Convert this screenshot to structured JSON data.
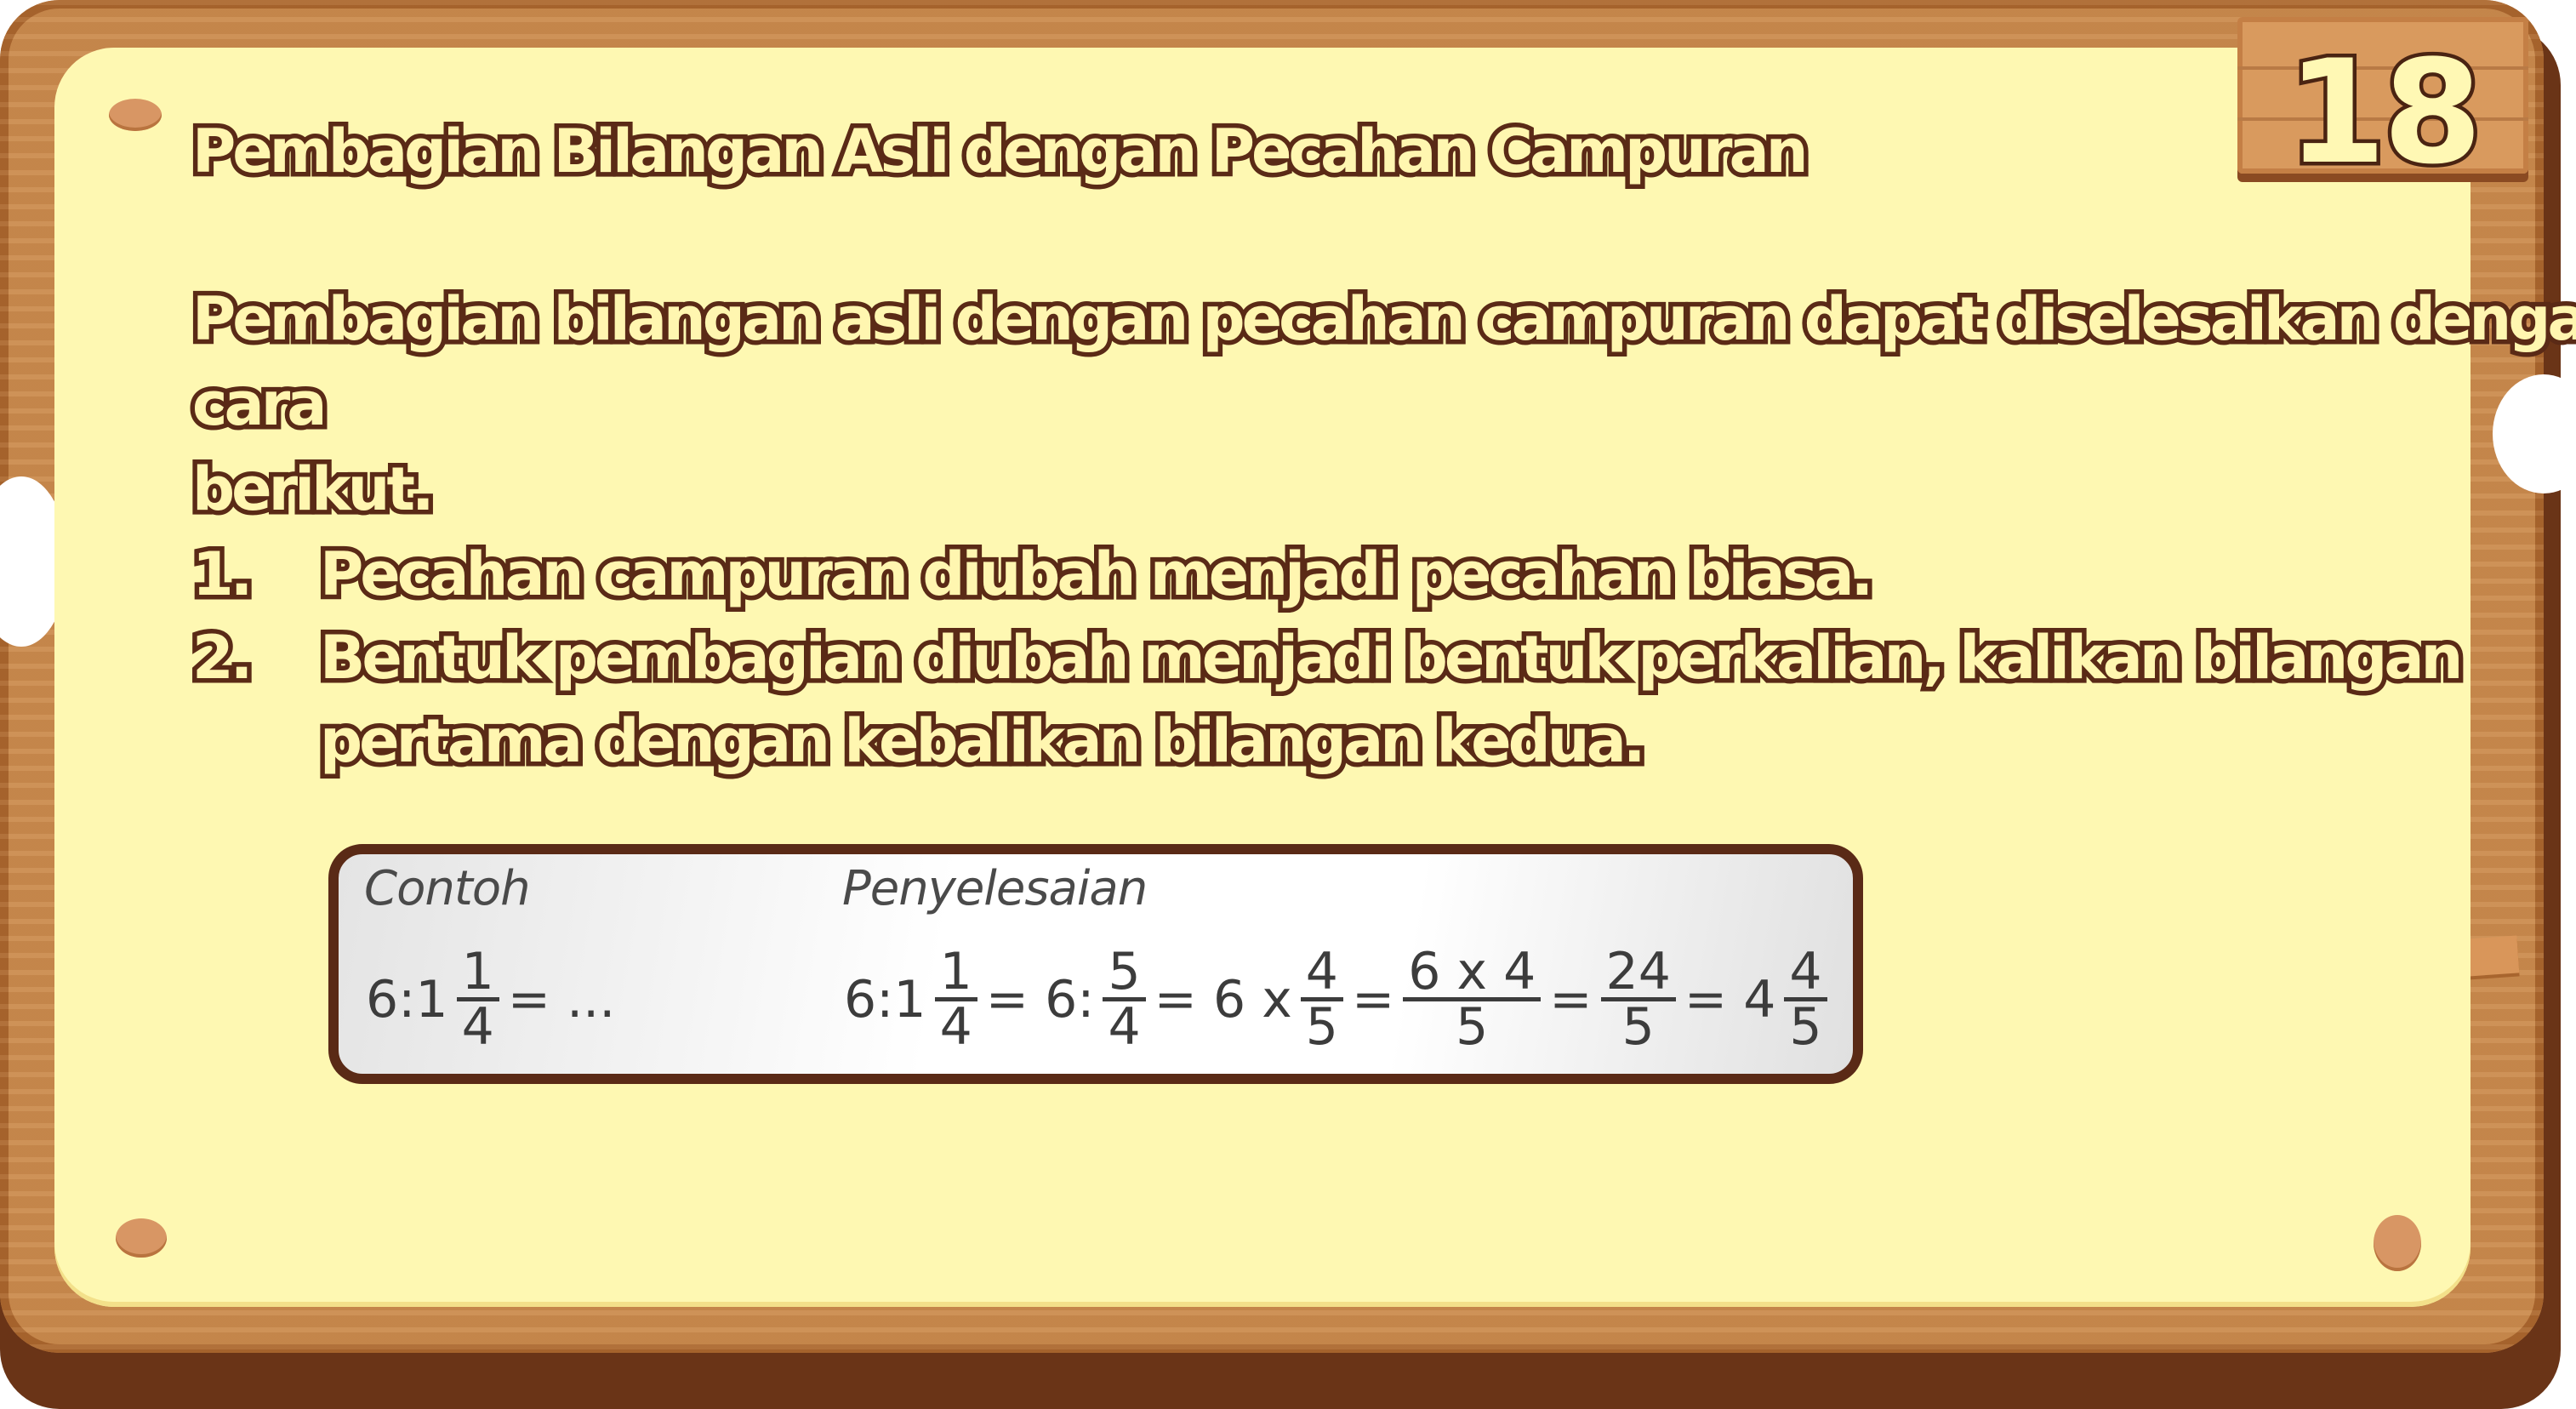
{
  "card_number": "18",
  "title": "Pembagian Bilangan Asli dengan Pecahan Campuran",
  "intro_lines": [
    "Pembagian bilangan asli dengan pecahan campuran dapat diselesaikan dengan",
    "cara",
    "berikut."
  ],
  "steps": [
    {
      "num": "1.",
      "lines": [
        "Pecahan campuran diubah menjadi pecahan biasa."
      ]
    },
    {
      "num": "2.",
      "lines": [
        "Bentuk pembagian diubah menjadi bentuk perkalian, kalikan bilangan",
        "pertama dengan kebalikan bilangan kedua."
      ]
    }
  ],
  "example": {
    "contoh_label": "Contoh",
    "penyelesaian_label": "Penyelesaian",
    "problem": {
      "lead": "6:1",
      "frac": {
        "num": "1",
        "den": "4"
      },
      "tail": "= ..."
    },
    "solution": {
      "t1": "6:1",
      "f1": {
        "num": "1",
        "den": "4"
      },
      "t2": "= 6:",
      "f2": {
        "num": "5",
        "den": "4"
      },
      "t3": "= 6 x",
      "f3": {
        "num": "4",
        "den": "5"
      },
      "t4": "=",
      "f4": {
        "num": "6 x 4",
        "den": "5"
      },
      "t5": "=",
      "f5": {
        "num": "24",
        "den": "5"
      },
      "t6": "= 4",
      "f6": {
        "num": "4",
        "den": "5"
      }
    }
  },
  "colors": {
    "panel": "#fef8b2",
    "wood": "#c98a4e",
    "wood_dark": "#6a3417",
    "text_fill": "#fff6b0",
    "text_outline": "#5a2a16"
  }
}
